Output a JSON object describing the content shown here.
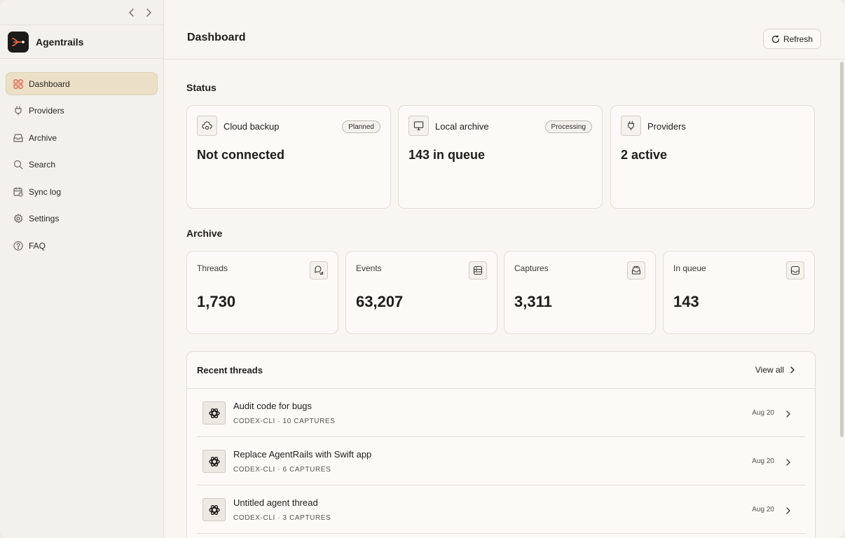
{
  "app": {
    "name": "Agentrails"
  },
  "sidebar": {
    "items": [
      {
        "label": "Dashboard",
        "icon": "grid-icon",
        "active": true
      },
      {
        "label": "Providers",
        "icon": "plug-icon"
      },
      {
        "label": "Archive",
        "icon": "archive-icon"
      },
      {
        "label": "Search",
        "icon": "search-icon"
      },
      {
        "label": "Sync log",
        "icon": "calendar-sync-icon"
      },
      {
        "label": "Settings",
        "icon": "gear-icon"
      },
      {
        "label": "FAQ",
        "icon": "help-circle-icon"
      }
    ]
  },
  "header": {
    "title": "Dashboard",
    "refresh_label": "Refresh"
  },
  "status": {
    "title": "Status",
    "cards": [
      {
        "title": "Cloud backup",
        "badge": "Planned",
        "value": "Not connected",
        "icon": "cloud-icon"
      },
      {
        "title": "Local archive",
        "badge": "Processing",
        "value": "143 in queue",
        "icon": "monitor-icon"
      },
      {
        "title": "Providers",
        "value": "2 active",
        "icon": "plug-icon"
      }
    ]
  },
  "archive": {
    "title": "Archive",
    "stats": [
      {
        "label": "Threads",
        "value": "1,730",
        "icon": "chat-icon"
      },
      {
        "label": "Events",
        "value": "63,207",
        "icon": "database-icon"
      },
      {
        "label": "Captures",
        "value": "3,311",
        "icon": "inbox-stack-icon"
      },
      {
        "label": "In queue",
        "value": "143",
        "icon": "inbox-icon"
      }
    ]
  },
  "recent": {
    "title": "Recent threads",
    "view_all": "View all",
    "threads": [
      {
        "title": "Audit code for bugs",
        "meta": "CODEX-CLI · 10 CAPTURES",
        "date": "Aug 20"
      },
      {
        "title": "Replace AgentRails with Swift app",
        "meta": "CODEX-CLI · 6 CAPTURES",
        "date": "Aug 20"
      },
      {
        "title": "Untitled agent thread",
        "meta": "CODEX-CLI · 3 CAPTURES",
        "date": "Aug 20"
      }
    ]
  },
  "colors": {
    "accent": "#d9573a",
    "active_bg": "#ebe0c7"
  }
}
